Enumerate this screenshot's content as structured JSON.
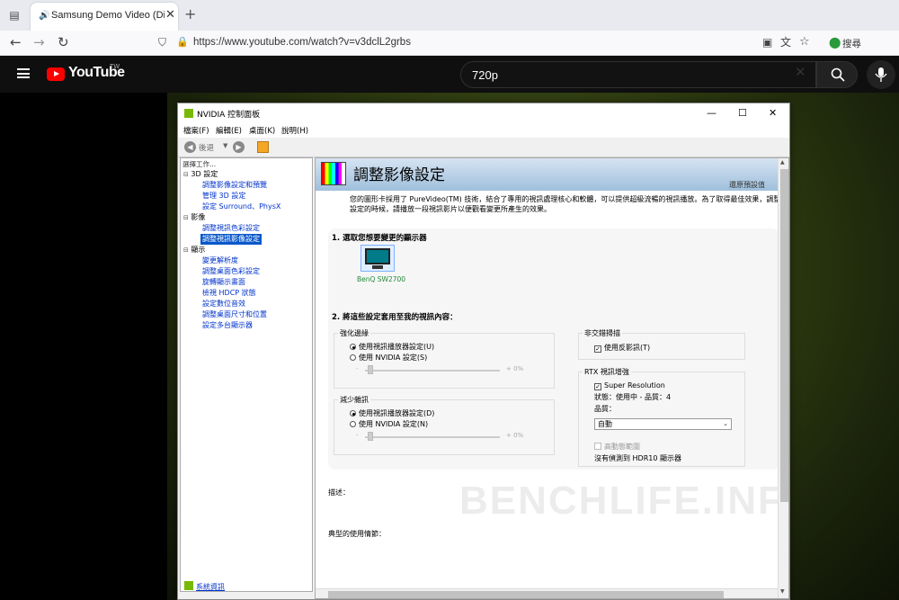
{
  "browser": {
    "tab_title": "Samsung Demo Video (Display",
    "url": "https://www.youtube.com/watch?v=v3dclL2grbs",
    "search_label": "搜尋"
  },
  "youtube": {
    "logo_text": "YouTube",
    "logo_region": "TW",
    "search_value": "720p"
  },
  "nvidia": {
    "window_title": "NVIDIA 控制面板",
    "menus": [
      "檔案(F)",
      "編輯(E)",
      "桌面(K)",
      "說明(H)"
    ],
    "toolbar_back": "後退",
    "sidebar": {
      "header": "選擇工作...",
      "categories": [
        {
          "label": "3D 設定",
          "items": [
            "調整影像設定和預覽",
            "管理 3D 設定",
            "設定 Surround、PhysX"
          ]
        },
        {
          "label": "影像",
          "items": [
            "調整視訊色彩設定",
            "調整視訊影像設定"
          ]
        },
        {
          "label": "顯示",
          "items": [
            "變更解析度",
            "調整桌面色彩設定",
            "旋轉顯示畫面",
            "檢視 HDCP 狀態",
            "設定數位音效",
            "調整桌面尺寸和位置",
            "設定多台顯示器"
          ]
        }
      ],
      "selected": "調整視訊影像設定",
      "system_info": "系統資訊"
    },
    "page": {
      "title": "調整影像設定",
      "restore_defaults": "還原預設值",
      "intro": "您的圖形卡採用了 PureVideo(TM) 技術，結合了專用的視訊處理核心和軟體，可以提供超級流暢的視訊播放。為了取得最佳效果，調整設定的時候，請播放一段視訊影片以便觀看變更所產生的效果。",
      "step1": "1. 選取您想要變更的顯示器",
      "monitor_name": "BenQ SW2700",
      "step2": "2. 將這些設定套用至我的視訊內容：",
      "edge": {
        "title": "強化邊緣",
        "opt_player": "使用視訊播放器設定(U)",
        "opt_nvidia": "使用 NVIDIA 設定(S)",
        "minus": "-",
        "plus": "+ 0%"
      },
      "noise": {
        "title": "減少雜訊",
        "opt_player": "使用視訊播放器設定(D)",
        "opt_nvidia": "使用 NVIDIA 設定(N)",
        "minus": "-",
        "plus": "+ 0%"
      },
      "deinterlace": {
        "title": "非交錯掃描",
        "inverse": "使用反影訊(T)"
      },
      "rtx": {
        "title": "RTX 視訊增強",
        "super_res": "Super Resolution",
        "status": "狀態：使用中 - 品質：4",
        "quality_label": "品質：",
        "quality_value": "自動",
        "hdr": "高動態範圍",
        "hdr_note": "沒有偵測到 HDR10 顯示器"
      },
      "description_label": "描述：",
      "usage_label": "典型的使用情節："
    }
  },
  "watermark": "BENCHLIFE.INFO"
}
